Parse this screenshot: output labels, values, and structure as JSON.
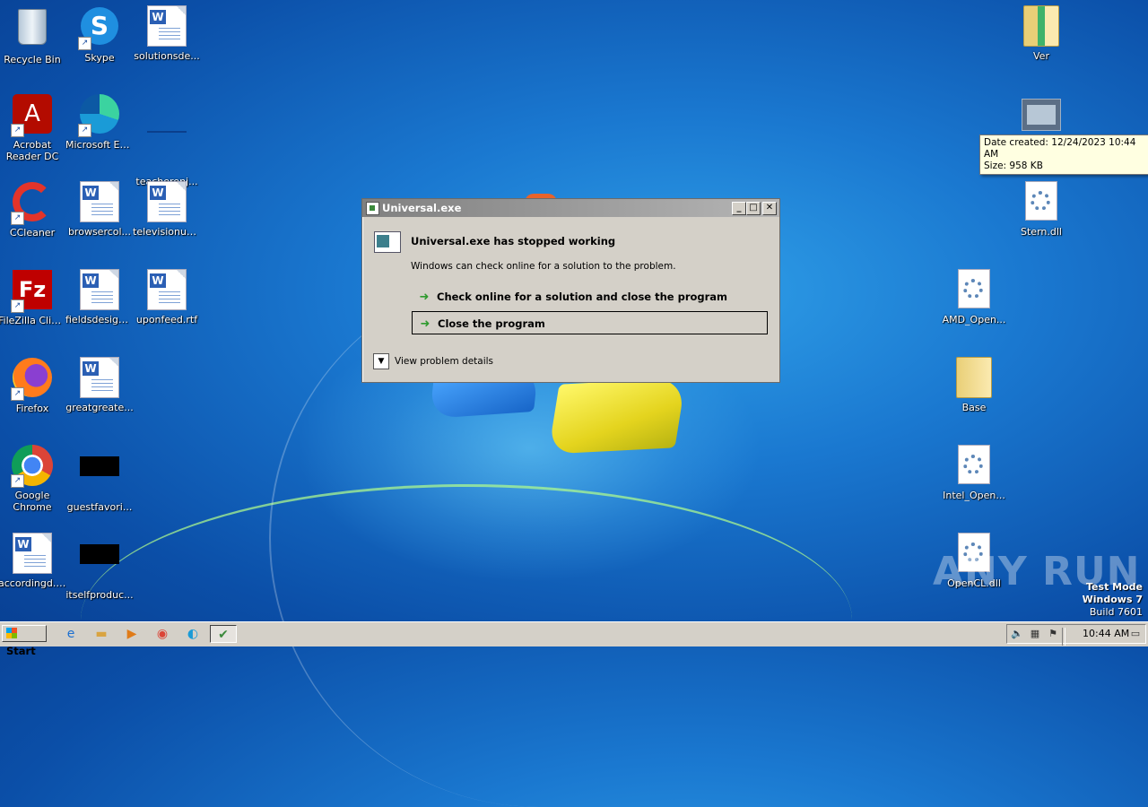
{
  "desktop": {
    "left_icons": [
      {
        "label": "Recycle Bin",
        "icon": "recycle-bin-icon"
      },
      {
        "label": "Skype",
        "icon": "skype-icon"
      },
      {
        "label": "solutionsde...",
        "icon": "word-doc-icon"
      },
      {
        "label": "Acrobat Reader DC",
        "icon": "acrobat-icon"
      },
      {
        "label": "Microsoft Edge",
        "icon": "edge-icon"
      },
      {
        "label": "teacherenj...",
        "icon": "blank-file-icon"
      },
      {
        "label": "CCleaner",
        "icon": "ccleaner-icon"
      },
      {
        "label": "browsercol...",
        "icon": "word-doc-icon"
      },
      {
        "label": "televisionus...",
        "icon": "word-doc-icon"
      },
      {
        "label": "FileZilla Client",
        "icon": "filezilla-icon"
      },
      {
        "label": "fieldsdesign...",
        "icon": "word-doc-icon"
      },
      {
        "label": "uponfeed.rtf",
        "icon": "word-doc-icon"
      },
      {
        "label": "Firefox",
        "icon": "firefox-icon"
      },
      {
        "label": "greatgreate...",
        "icon": "word-doc-icon"
      },
      {
        "label": "Google Chrome",
        "icon": "chrome-icon"
      },
      {
        "label": "guestfavori...",
        "icon": "black-thumb-icon"
      },
      {
        "label": "accordingd.rtf",
        "icon": "word-doc-icon"
      },
      {
        "label": "itselfproduc...",
        "icon": "black-thumb-icon"
      }
    ],
    "right_icons": [
      {
        "label": "Ver",
        "icon": "folder-icon"
      },
      {
        "label": "",
        "icon": "window-app-icon"
      },
      {
        "label": "Stern.dll",
        "icon": "dll-icon"
      },
      {
        "label": "AMD_Open...",
        "icon": "dll-icon"
      },
      {
        "label": "Base",
        "icon": "folder-icon"
      },
      {
        "label": "Intel_Open...",
        "icon": "dll-icon"
      },
      {
        "label": "OpenCL.dll",
        "icon": "dll-icon"
      }
    ],
    "tooltip": {
      "line1": "Date created: 12/24/2023 10:44 AM",
      "line2": "Size: 958 KB"
    },
    "watermark": "ANY RUN",
    "test_mode": {
      "line1": "Test Mode",
      "line2": "Windows 7",
      "line3": "Build 7601"
    }
  },
  "dialog": {
    "title": "Universal.exe",
    "heading": "Universal.exe has stopped working",
    "subtext": "Windows can check online for a solution to the problem.",
    "option_check_online": "Check online for a solution and close the program",
    "option_close": "Close the program",
    "details_label": "View problem details",
    "titlebar_buttons": {
      "minimize": "_",
      "maximize": "□",
      "close": "✕"
    }
  },
  "taskbar": {
    "start_label": "Start",
    "pinned": [
      "ie-icon",
      "explorer-icon",
      "media-player-icon",
      "chrome-icon",
      "edge-icon",
      "universal-app-icon"
    ],
    "clock": "10:44 AM"
  },
  "colors": {
    "desktop_bg": "#1a78d0",
    "dialog_bg": "#d4d0c8",
    "tooltip_bg": "#ffffe1",
    "arrow_green": "#2e9a2e"
  }
}
